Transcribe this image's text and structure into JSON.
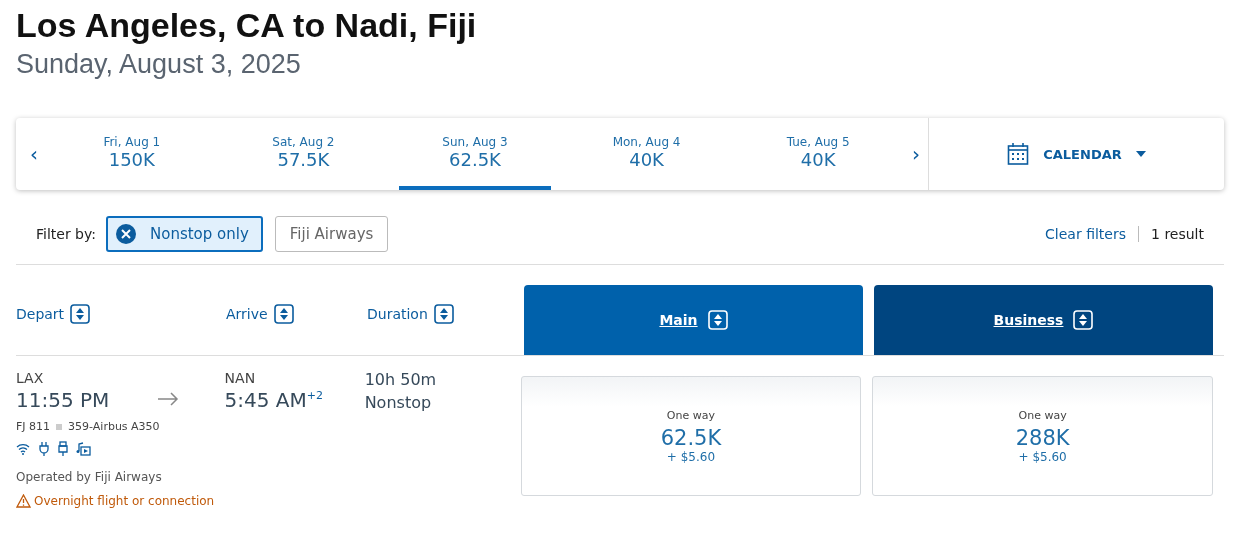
{
  "title": "Los Angeles, CA to Nadi, Fiji",
  "subtitle": "Sunday, August 3, 2025",
  "dates": [
    {
      "day": "Fri, Aug 1",
      "price": "150K",
      "selected": false
    },
    {
      "day": "Sat, Aug 2",
      "price": "57.5K",
      "selected": false
    },
    {
      "day": "Sun, Aug 3",
      "price": "62.5K",
      "selected": true
    },
    {
      "day": "Mon, Aug 4",
      "price": "40K",
      "selected": false
    },
    {
      "day": "Tue, Aug 5",
      "price": "40K",
      "selected": false
    }
  ],
  "prev": "‹",
  "next": "›",
  "calendar": "CALENDAR",
  "filter_label": "Filter by:",
  "filters": [
    {
      "label": "Nonstop only",
      "selected": true
    },
    {
      "label": "Fiji Airways",
      "selected": false
    }
  ],
  "clear_filters": "Clear filters",
  "result_count": "1 result",
  "columns": [
    "Depart",
    "Arrive",
    "Duration"
  ],
  "cabins": [
    {
      "label": "Main",
      "color": "#0061ab"
    },
    {
      "label": "Business",
      "color": "#004580"
    }
  ],
  "flight": {
    "from": "LAX",
    "depart": "11:55 PM",
    "to": "NAN",
    "arrive": "5:45 AM$^{+2}$",
    "duration": "10h 50m",
    "stops": "Nonstop",
    "number": "FJ 811",
    "aircraft": "359-Airbus A350",
    "operator": "Operated by Fiji Airways",
    "warning": "Overnight flight or connection",
    "fares": [
      {
        "label": "One way",
        "miles": "62.5K",
        "tax": "+ $5.60"
      },
      {
        "label": "One way",
        "miles": "288K",
        "tax": "+ $5.60"
      }
    ]
  }
}
